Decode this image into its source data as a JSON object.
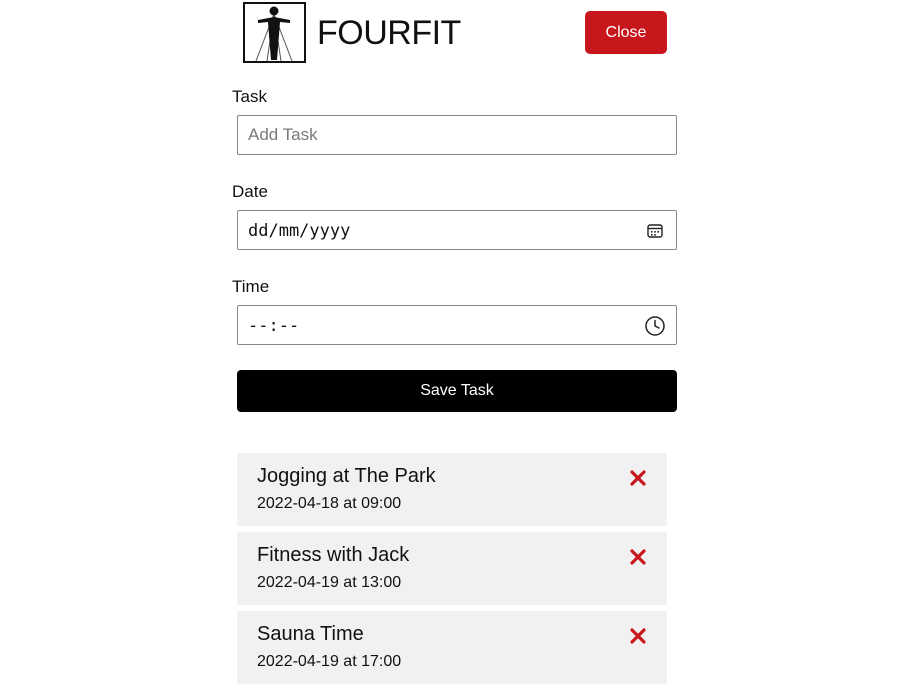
{
  "header": {
    "brand": "FOURFIT",
    "logo_icon": "fitness-figure-logo-icon",
    "close_label": "Close",
    "accent_color": "#c8161d"
  },
  "form": {
    "task": {
      "label": "Task",
      "placeholder": "Add Task",
      "value": ""
    },
    "date": {
      "label": "Date",
      "value": "dd/mm/yyyy",
      "icon": "calendar-icon"
    },
    "time": {
      "label": "Time",
      "value": "--:--",
      "icon": "clock-icon"
    },
    "save_label": "Save Task"
  },
  "tasks": [
    {
      "title": "Jogging at The Park",
      "datetime": "2022-04-18 at 09:00",
      "delete_icon": "delete-x-icon"
    },
    {
      "title": "Fitness with Jack",
      "datetime": "2022-04-19 at 13:00",
      "delete_icon": "delete-x-icon"
    },
    {
      "title": "Sauna Time",
      "datetime": "2022-04-19 at 17:00",
      "delete_icon": "delete-x-icon"
    }
  ]
}
